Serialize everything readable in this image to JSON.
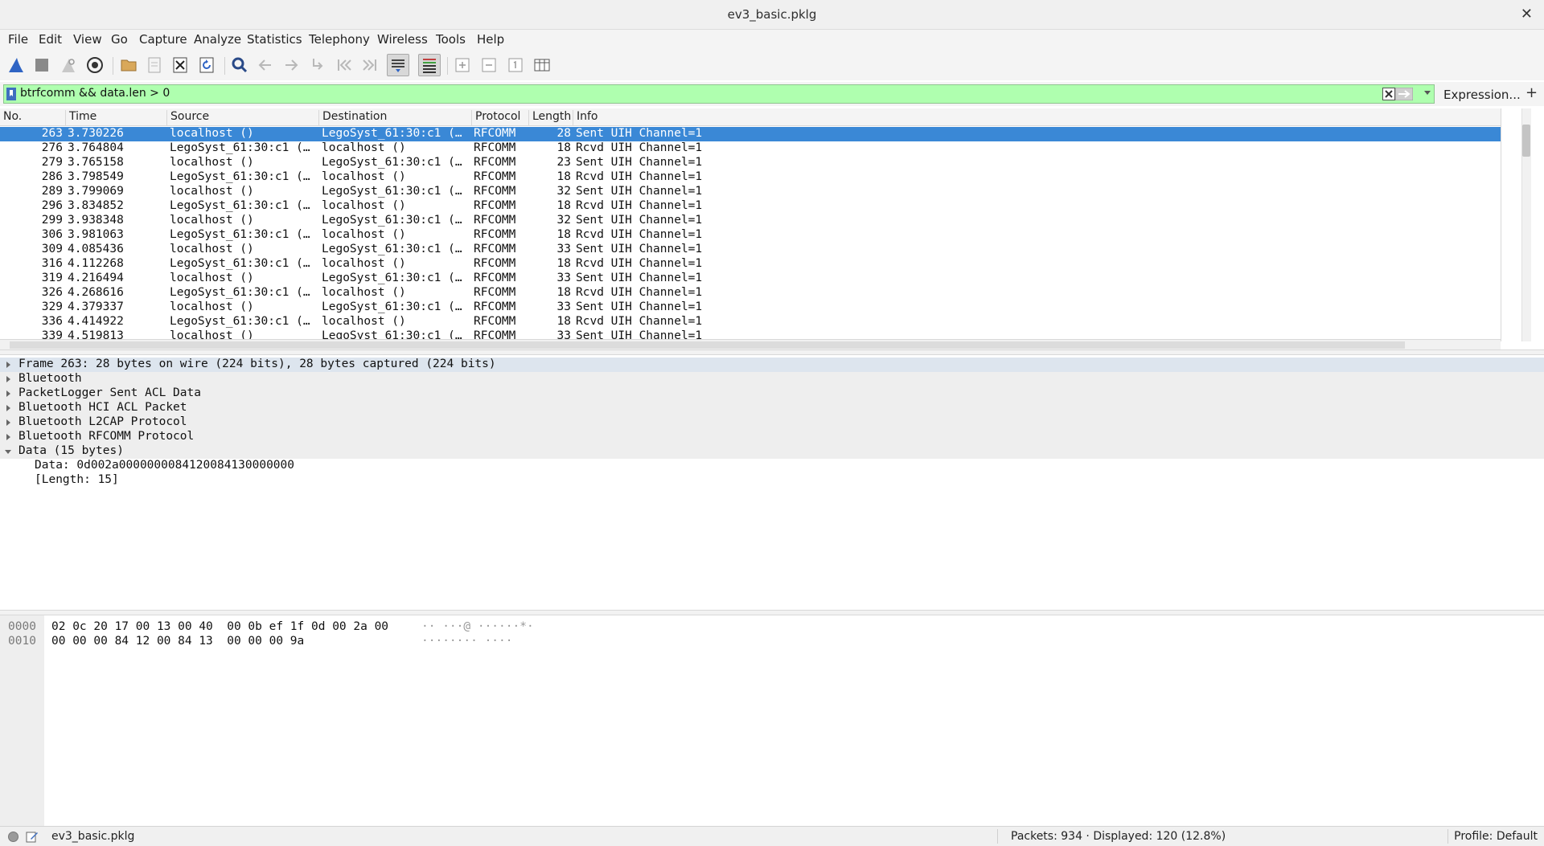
{
  "window": {
    "title": "ev3_basic.pklg"
  },
  "menu": [
    "File",
    "Edit",
    "View",
    "Go",
    "Capture",
    "Analyze",
    "Statistics",
    "Telephony",
    "Wireless",
    "Tools",
    "Help"
  ],
  "toolbar": {
    "icons": [
      "shark-fin-start-icon",
      "stop-square-icon",
      "restart-fin-icon",
      "gear-options-icon",
      "open-folder-icon",
      "file-save-icon",
      "close-file-icon",
      "reload-icon",
      "search-icon",
      "back-arrow-icon",
      "forward-arrow-icon",
      "goto-packet-icon",
      "first-packet-icon",
      "last-packet-icon",
      "autoscroll-icon",
      "colorize-icon",
      "zoom-in-icon",
      "zoom-out-icon",
      "normal-size-icon",
      "resize-columns-icon"
    ]
  },
  "filter": {
    "value": "btrfcomm && data.len > 0",
    "expression_label": "Expression...",
    "plus_label": "+",
    "bg_color": "#afffaf"
  },
  "packet_list": {
    "columns": [
      "No.",
      "Time",
      "Source",
      "Destination",
      "Protocol",
      "Length",
      "Info"
    ],
    "rows": [
      {
        "no": "263",
        "time": "3.730226",
        "src": "localhost ()",
        "dst": "LegoSyst_61:30:c1 (…",
        "proto": "RFCOMM",
        "len": "28",
        "info": "Sent UIH Channel=1",
        "selected": true
      },
      {
        "no": "276",
        "time": "3.764804",
        "src": "LegoSyst_61:30:c1 (…",
        "dst": "localhost ()",
        "proto": "RFCOMM",
        "len": "18",
        "info": "Rcvd UIH Channel=1"
      },
      {
        "no": "279",
        "time": "3.765158",
        "src": "localhost ()",
        "dst": "LegoSyst_61:30:c1 (…",
        "proto": "RFCOMM",
        "len": "23",
        "info": "Sent UIH Channel=1"
      },
      {
        "no": "286",
        "time": "3.798549",
        "src": "LegoSyst_61:30:c1 (…",
        "dst": "localhost ()",
        "proto": "RFCOMM",
        "len": "18",
        "info": "Rcvd UIH Channel=1"
      },
      {
        "no": "289",
        "time": "3.799069",
        "src": "localhost ()",
        "dst": "LegoSyst_61:30:c1 (…",
        "proto": "RFCOMM",
        "len": "32",
        "info": "Sent UIH Channel=1"
      },
      {
        "no": "296",
        "time": "3.834852",
        "src": "LegoSyst_61:30:c1 (…",
        "dst": "localhost ()",
        "proto": "RFCOMM",
        "len": "18",
        "info": "Rcvd UIH Channel=1"
      },
      {
        "no": "299",
        "time": "3.938348",
        "src": "localhost ()",
        "dst": "LegoSyst_61:30:c1 (…",
        "proto": "RFCOMM",
        "len": "32",
        "info": "Sent UIH Channel=1"
      },
      {
        "no": "306",
        "time": "3.981063",
        "src": "LegoSyst_61:30:c1 (…",
        "dst": "localhost ()",
        "proto": "RFCOMM",
        "len": "18",
        "info": "Rcvd UIH Channel=1"
      },
      {
        "no": "309",
        "time": "4.085436",
        "src": "localhost ()",
        "dst": "LegoSyst_61:30:c1 (…",
        "proto": "RFCOMM",
        "len": "33",
        "info": "Sent UIH Channel=1"
      },
      {
        "no": "316",
        "time": "4.112268",
        "src": "LegoSyst_61:30:c1 (…",
        "dst": "localhost ()",
        "proto": "RFCOMM",
        "len": "18",
        "info": "Rcvd UIH Channel=1"
      },
      {
        "no": "319",
        "time": "4.216494",
        "src": "localhost ()",
        "dst": "LegoSyst_61:30:c1 (…",
        "proto": "RFCOMM",
        "len": "33",
        "info": "Sent UIH Channel=1"
      },
      {
        "no": "326",
        "time": "4.268616",
        "src": "LegoSyst_61:30:c1 (…",
        "dst": "localhost ()",
        "proto": "RFCOMM",
        "len": "18",
        "info": "Rcvd UIH Channel=1"
      },
      {
        "no": "329",
        "time": "4.379337",
        "src": "localhost ()",
        "dst": "LegoSyst_61:30:c1 (…",
        "proto": "RFCOMM",
        "len": "33",
        "info": "Sent UIH Channel=1"
      },
      {
        "no": "336",
        "time": "4.414922",
        "src": "LegoSyst_61:30:c1 (…",
        "dst": "localhost ()",
        "proto": "RFCOMM",
        "len": "18",
        "info": "Rcvd UIH Channel=1"
      },
      {
        "no": "339",
        "time": "4.519813",
        "src": "localhost ()",
        "dst": "LegoSyst_61:30:c1 (…",
        "proto": "RFCOMM",
        "len": "33",
        "info": "Sent UIH Channel=1"
      }
    ],
    "selected_color": "#3a88d6"
  },
  "detail_tree": [
    {
      "label": "Frame 263: 28 bytes on wire (224 bits), 28 bytes captured (224 bits)",
      "state": "closed",
      "level": 0,
      "highlight": true
    },
    {
      "label": "Bluetooth",
      "state": "closed",
      "level": 0
    },
    {
      "label": "PacketLogger Sent ACL Data",
      "state": "closed",
      "level": 0
    },
    {
      "label": "Bluetooth HCI ACL Packet",
      "state": "closed",
      "level": 0
    },
    {
      "label": "Bluetooth L2CAP Protocol",
      "state": "closed",
      "level": 0
    },
    {
      "label": "Bluetooth RFCOMM Protocol",
      "state": "closed",
      "level": 0
    },
    {
      "label": "Data (15 bytes)",
      "state": "open",
      "level": 0
    },
    {
      "label": "Data: 0d002a0000000084120084130000000",
      "state": "none",
      "level": 1
    },
    {
      "label": "[Length: 15]",
      "state": "none",
      "level": 1
    }
  ],
  "hex_dump": [
    {
      "offset": "0000",
      "bytes": "02 0c 20 17 00 13 00 40  00 0b ef 1f 0d 00 2a 00",
      "ascii": "·· ···@ ······*·"
    },
    {
      "offset": "0010",
      "bytes": "00 00 00 84 12 00 84 13  00 00 00 9a",
      "ascii": "········ ····"
    }
  ],
  "status": {
    "file": "ev3_basic.pklg",
    "packets": "Packets: 934 · Displayed: 120 (12.8%)",
    "profile": "Profile: Default"
  }
}
